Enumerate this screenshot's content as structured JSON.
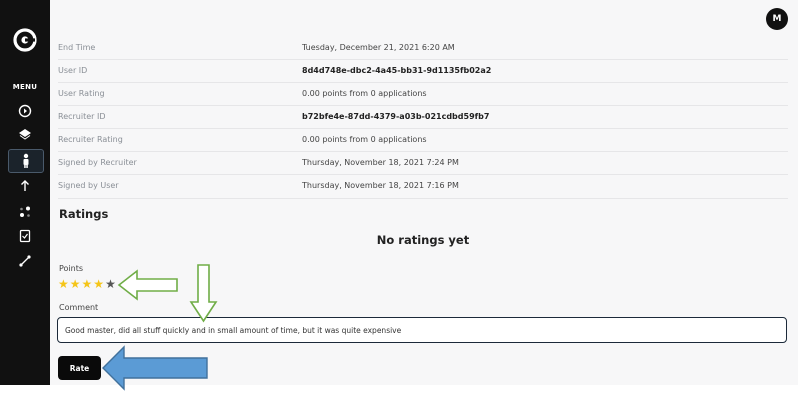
{
  "sidebar": {
    "menu_label": "MENU",
    "icons": [
      "logo-icon",
      "dashboard-icon",
      "layers-icon",
      "worker-icon",
      "upload-icon",
      "nodes-icon",
      "checklist-icon",
      "link-icon"
    ]
  },
  "header": {
    "avatar_initial": "M"
  },
  "details": [
    {
      "label": "End Time",
      "value": "Tuesday, December 21, 2021 6:20 AM"
    },
    {
      "label": "User ID",
      "value": "8d4d748e-dbc2-4a45-bb31-9d1135fb02a2"
    },
    {
      "label": "User Rating",
      "value": "0.00 points from 0 applications"
    },
    {
      "label": "Recruiter ID",
      "value": "b72bfe4e-87dd-4379-a03b-021cdbd59fb7"
    },
    {
      "label": "Recruiter Rating",
      "value": "0.00 points from 0 applications"
    },
    {
      "label": "Signed by Recruiter",
      "value": "Thursday, November 18, 2021 7:24 PM"
    },
    {
      "label": "Signed by User",
      "value": "Thursday, November 18, 2021 7:16 PM"
    }
  ],
  "ratings": {
    "heading": "Ratings",
    "empty_text": "No ratings yet",
    "points_label": "Points",
    "stars_value": 4,
    "stars_max": 5,
    "comment_label": "Comment",
    "comment_value": "Good master, did all stuff quickly and in small amount of time, but it was quite expensive",
    "rate_button": "Rate"
  },
  "colors": {
    "sidebar_bg": "#111111",
    "star_filled": "#f5c518",
    "star_empty": "#555555",
    "annotation_green": "#70ad47",
    "annotation_blue": "#5b9bd5"
  }
}
